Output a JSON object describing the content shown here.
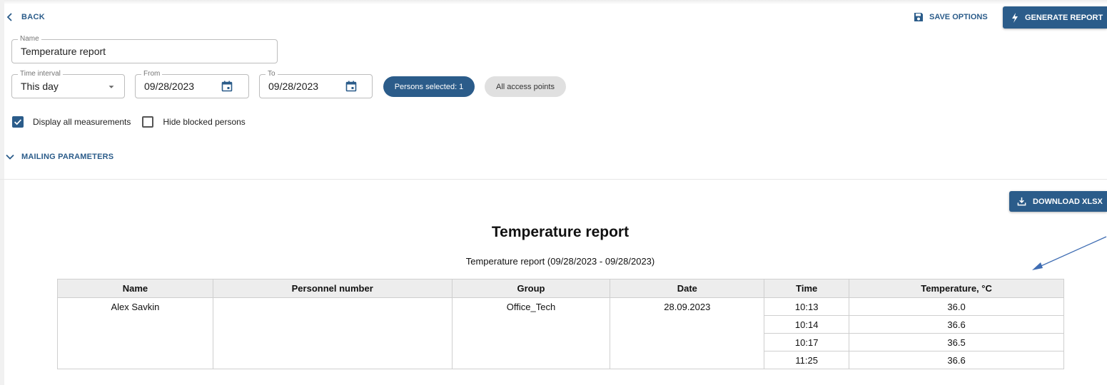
{
  "header": {
    "back_label": "BACK",
    "save_label": "SAVE OPTIONS",
    "generate_label": "GENERATE REPORT"
  },
  "form": {
    "name": {
      "label": "Name",
      "value": "Temperature report"
    },
    "time_interval": {
      "label": "Time interval",
      "value": "This day"
    },
    "from": {
      "label": "From",
      "value": "09/28/2023"
    },
    "to": {
      "label": "To",
      "value": "09/28/2023"
    },
    "persons_chip": "Persons selected: 1",
    "access_chip": "All access points",
    "display_all_label": "Display all measurements",
    "display_all_checked": true,
    "hide_blocked_label": "Hide blocked persons",
    "hide_blocked_checked": false,
    "mailing_label": "MAILING PARAMETERS"
  },
  "report": {
    "download_label": "DOWNLOAD XLSX",
    "title": "Temperature report",
    "subtitle": "Temperature report (09/28/2023 - 09/28/2023)",
    "columns": [
      "Name",
      "Personnel number",
      "Group",
      "Date",
      "Time",
      "Temperature, °C"
    ],
    "person": {
      "name": "Alex Savkin",
      "personnel_number": "",
      "group": "Office_Tech",
      "date": "28.09.2023"
    },
    "measurements": [
      {
        "time": "10:13",
        "temperature": "36.0"
      },
      {
        "time": "10:14",
        "temperature": "36.6"
      },
      {
        "time": "10:17",
        "temperature": "36.5"
      },
      {
        "time": "11:25",
        "temperature": "36.6"
      }
    ]
  },
  "colors": {
    "primary": "#2b5c8a",
    "chip_grey": "#e0e0e0",
    "table_header": "#ededed",
    "annotation_arrow": "#3f6db3"
  }
}
